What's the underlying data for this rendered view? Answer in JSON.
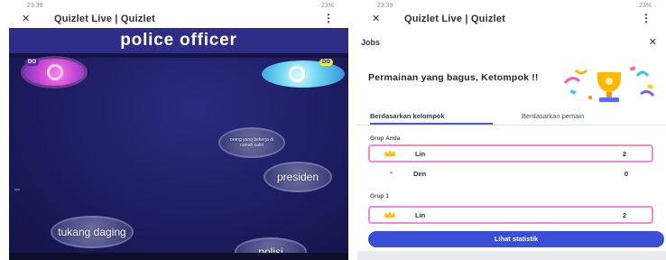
{
  "left_phone": {
    "status_time": "23:39",
    "status_sys": "23%",
    "close_glyph": "✕",
    "window_title": "Quizlet Live | Quizlet",
    "menu_glyph": "⋮",
    "game_title": "police officer",
    "badge_pink": "DO",
    "badge_blue": "DO",
    "bubbles": {
      "small": "orang yang bekerja di rumah sakit",
      "presiden": "presiden",
      "tukang": "tukang daging",
      "polisi": "polisi"
    }
  },
  "right_phone": {
    "status_time": "23:39",
    "status_sys": "23%",
    "close_glyph": "✕",
    "window_title": "Quizlet Live | Quizlet",
    "menu_glyph": "⋮",
    "header_label": "Jobs",
    "header_close": "✕",
    "headline": "Permainan yang bagus, Ketompok !!",
    "tabs": {
      "by_group": "Berdasarkan kelompok",
      "by_player": "Berdasarkan pemain"
    },
    "sections": {
      "your_group": "Grup Anda",
      "group_one": "Grup 1"
    },
    "rows": {
      "lin1": {
        "name": "Lin",
        "score": "2"
      },
      "den": {
        "name": "Den",
        "score": "0"
      },
      "lin2": {
        "name": "Lin",
        "score": "2"
      }
    },
    "cta": "Lihat statistik"
  },
  "colors": {
    "game_background": "#1c1c60",
    "game_header": "#2e2e86",
    "accent_blue": "#3a4fd8",
    "highlight_pink": "#f08ccd"
  }
}
